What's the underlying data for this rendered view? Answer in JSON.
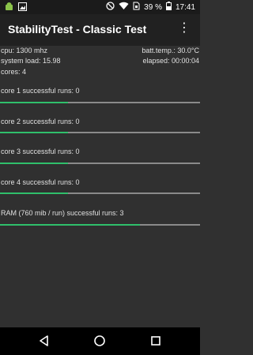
{
  "status_bar": {
    "battery_percent": "39 %",
    "time": "17:41",
    "icons": [
      "android-icon",
      "image-icon",
      "dnd-icon",
      "wifi-icon",
      "sim-icon",
      "battery-icon"
    ]
  },
  "app_bar": {
    "title": "StabilityTest - Classic Test",
    "menu_icon": "overflow-menu-icon"
  },
  "info": {
    "cpu": "cpu: 1300 mhz",
    "batt_temp": "batt.temp.: 30.0°C",
    "system_load": "system load: 15.98",
    "elapsed": "elapsed: 00:00:04",
    "cores": "cores: 4"
  },
  "tests": [
    {
      "label": "core 1 successful runs: 0",
      "progress": 0.34
    },
    {
      "label": "core 2 successful runs: 0",
      "progress": 0.34
    },
    {
      "label": "core 3 successful runs: 0",
      "progress": 0.34
    },
    {
      "label": "core 4 successful runs: 0",
      "progress": 0.34
    },
    {
      "label": "RAM (760 mib / run) successful runs: 3",
      "progress": 0.7
    }
  ],
  "colors": {
    "progress_fill": "#2fbf6b",
    "progress_track": "#8a8a8a",
    "background": "#303030",
    "app_bar": "#212121"
  },
  "nav_bar": {
    "buttons": [
      "back-icon",
      "home-icon",
      "recents-icon"
    ]
  }
}
